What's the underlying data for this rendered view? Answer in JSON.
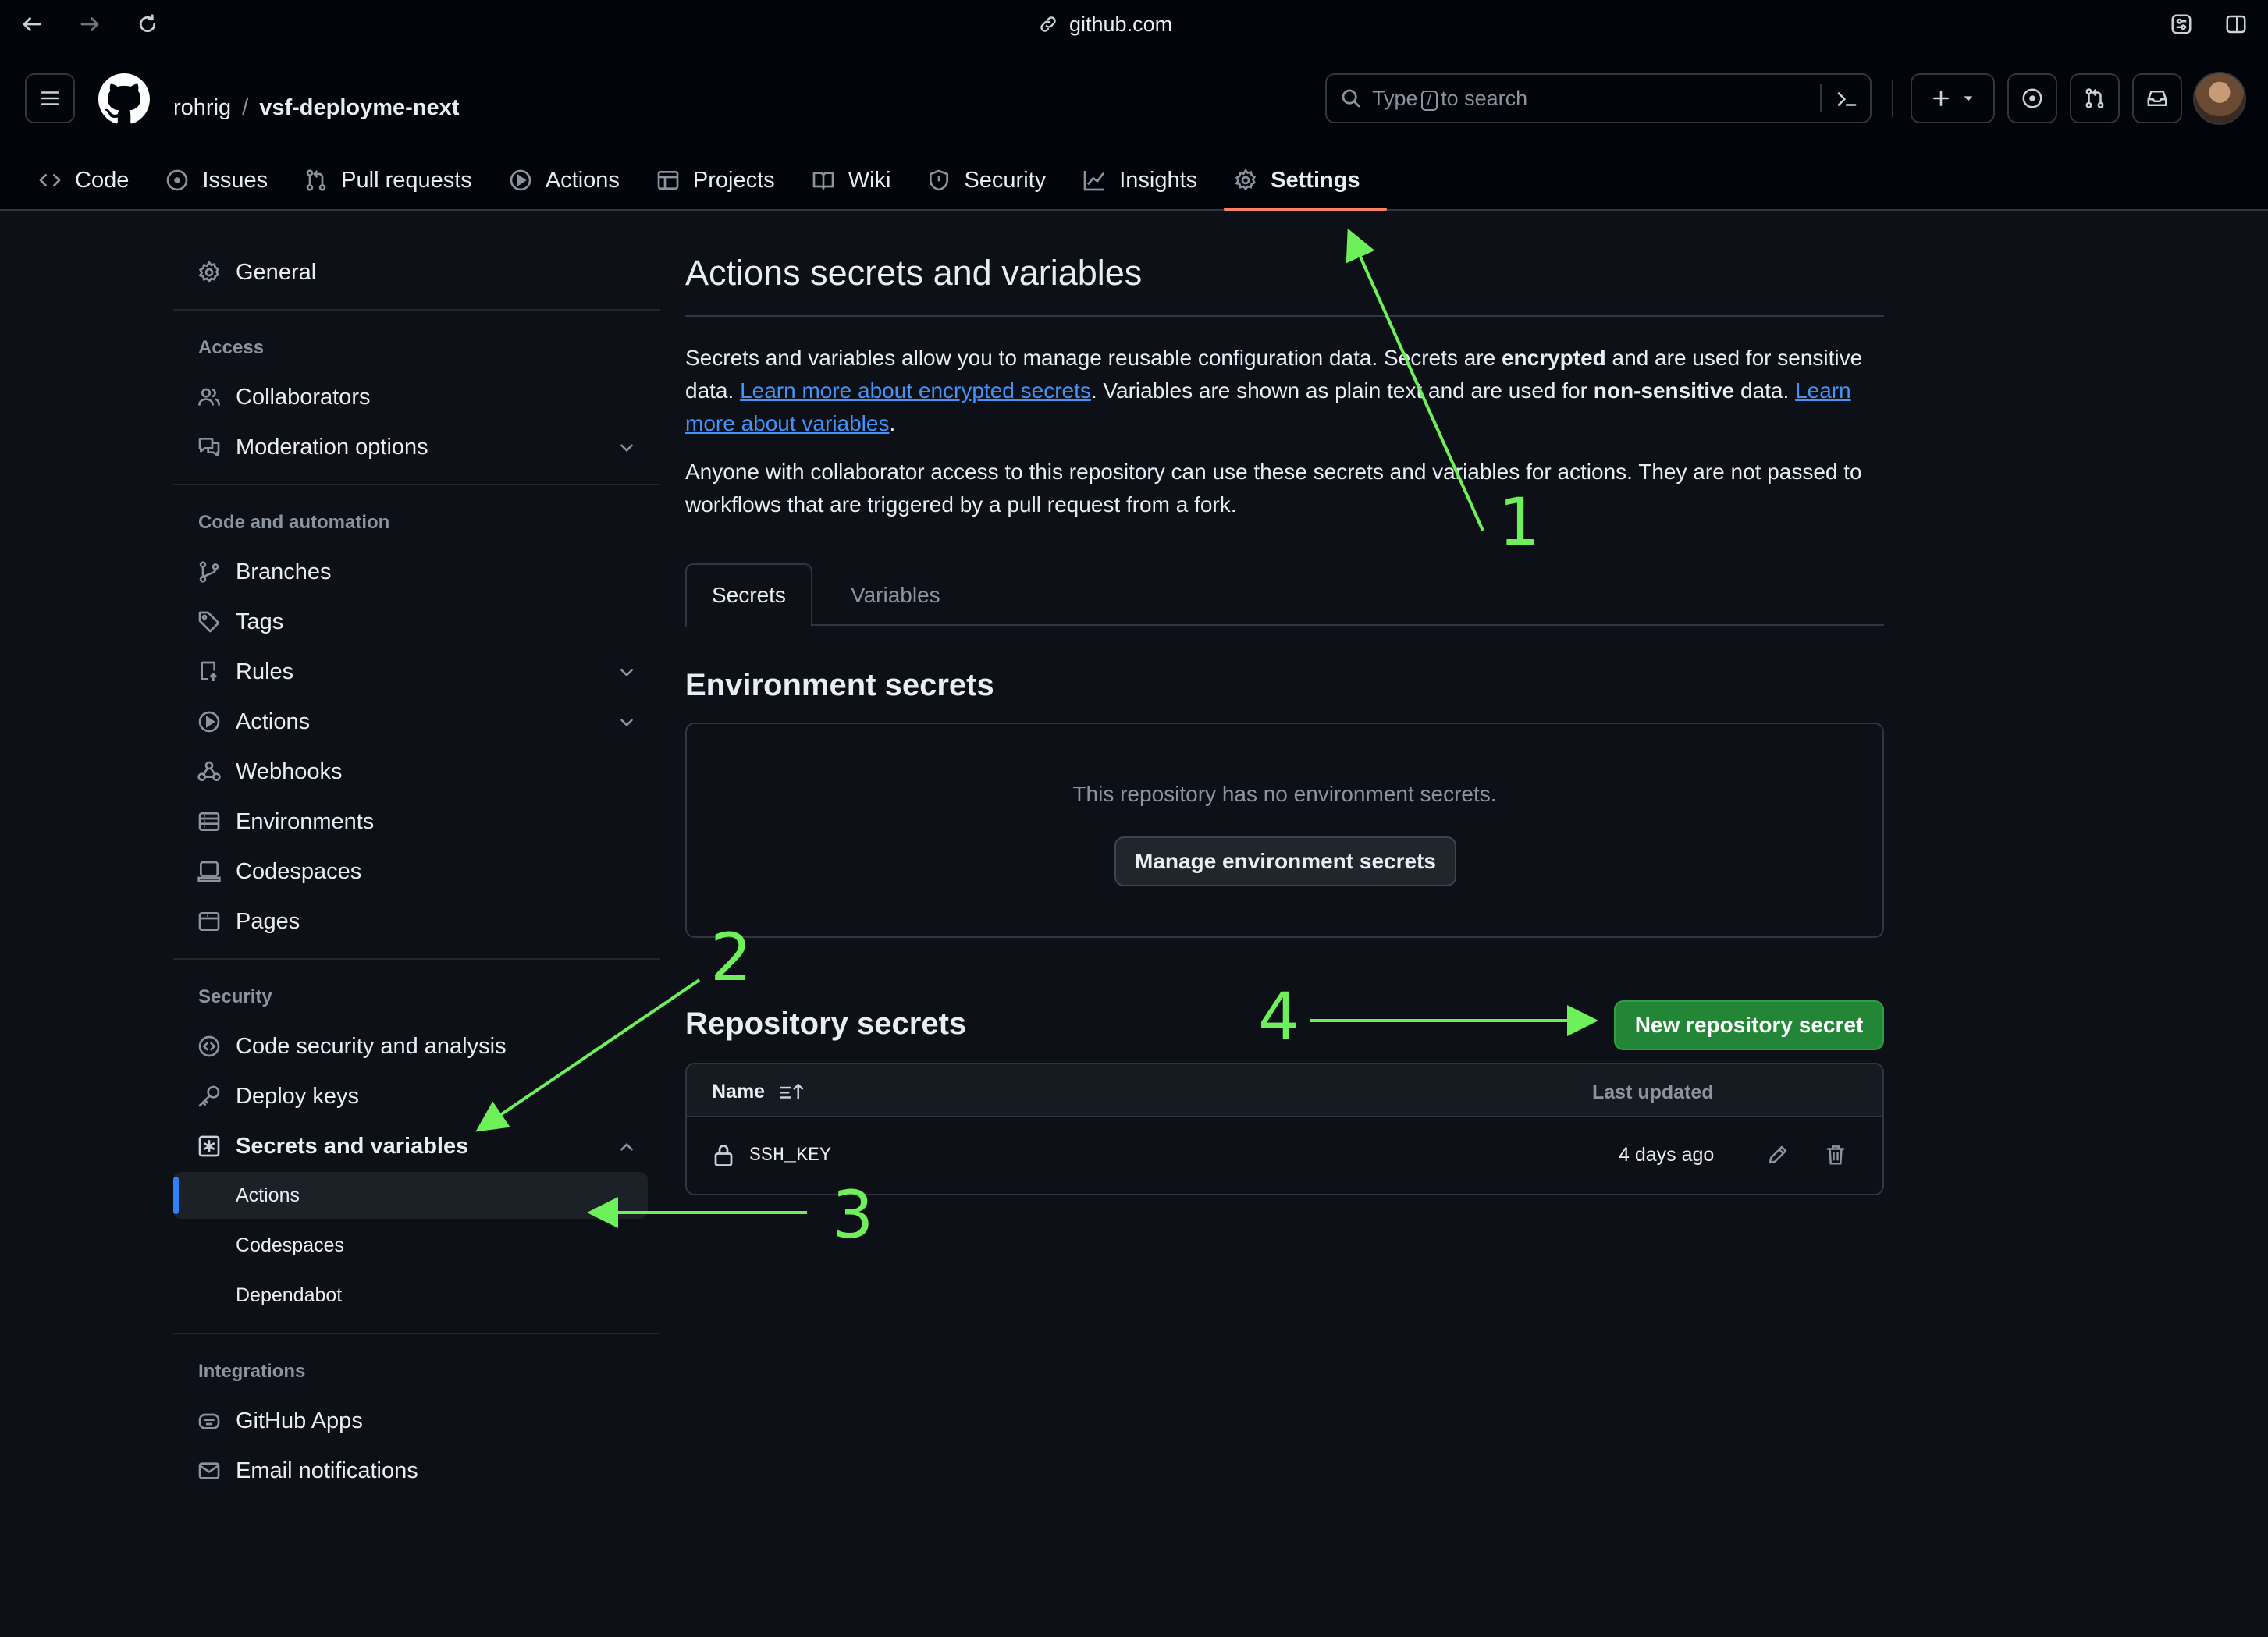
{
  "browser": {
    "url": "github.com"
  },
  "header": {
    "owner": "rohrig",
    "separator": "/",
    "repo": "vsf-deployme-next",
    "search_prefix": "Type",
    "search_key": "/",
    "search_suffix": "to search"
  },
  "repo_tabs": [
    {
      "label": "Code",
      "icon": "code-icon"
    },
    {
      "label": "Issues",
      "icon": "issue-icon"
    },
    {
      "label": "Pull requests",
      "icon": "pull-request-icon"
    },
    {
      "label": "Actions",
      "icon": "play-icon"
    },
    {
      "label": "Projects",
      "icon": "table-icon"
    },
    {
      "label": "Wiki",
      "icon": "book-icon"
    },
    {
      "label": "Security",
      "icon": "shield-icon"
    },
    {
      "label": "Insights",
      "icon": "graph-icon"
    },
    {
      "label": "Settings",
      "icon": "gear-icon",
      "active": true
    }
  ],
  "sidebar": {
    "general": "General",
    "access_heading": "Access",
    "collaborators": "Collaborators",
    "moderation": "Moderation options",
    "code_heading": "Code and automation",
    "branches": "Branches",
    "tags": "Tags",
    "rules": "Rules",
    "actions": "Actions",
    "webhooks": "Webhooks",
    "environments": "Environments",
    "codespaces": "Codespaces",
    "pages": "Pages",
    "security_heading": "Security",
    "code_security": "Code security and analysis",
    "deploy_keys": "Deploy keys",
    "secrets": "Secrets and variables",
    "sub_actions": "Actions",
    "sub_codespaces": "Codespaces",
    "sub_dependabot": "Dependabot",
    "integrations_heading": "Integrations",
    "github_apps": "GitHub Apps",
    "email_notifications": "Email notifications"
  },
  "main": {
    "title": "Actions secrets and variables",
    "p1_a": "Secrets and variables allow you to manage reusable configuration data. Secrets are ",
    "p1_b": "encrypted",
    "p1_c": " and are used for sensitive data. ",
    "p1_link1": "Learn more about encrypted secrets",
    "p1_d": ". Variables are shown as plain text and are used for ",
    "p1_e": "non-sensitive",
    "p1_f": " data. ",
    "p1_link2": "Learn more about variables",
    "p1_g": ".",
    "p2": "Anyone with collaborator access to this repository can use these secrets and variables for actions. They are not passed to workflows that are triggered by a pull request from a fork.",
    "tab_secrets": "Secrets",
    "tab_variables": "Variables",
    "env_heading": "Environment secrets",
    "env_empty": "This repository has no environment secrets.",
    "env_button": "Manage environment secrets",
    "repo_heading": "Repository secrets",
    "new_button": "New repository secret",
    "col_name": "Name",
    "col_updated": "Last updated",
    "secrets": [
      {
        "name": "SSH_KEY",
        "updated": "4 days ago"
      }
    ]
  },
  "annotations": {
    "a1": "1",
    "a2": "2",
    "a3": "3",
    "a4": "4"
  },
  "colors": {
    "annotation": "#6ef05a",
    "accent": "#f78166",
    "link": "#4493f8",
    "primary_button": "#238636"
  }
}
